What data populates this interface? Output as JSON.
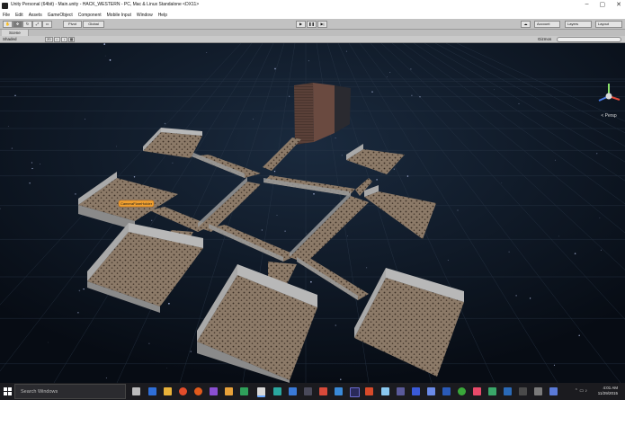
{
  "window": {
    "title": "Unity Personal (64bit) - Main.unity - HACK_WESTERN - PC, Mac & Linux Standalone <DX11>",
    "controls": [
      "–",
      "▢",
      "✕"
    ]
  },
  "menu": [
    "File",
    "Edit",
    "Assets",
    "GameObject",
    "Component",
    "Mobile Input",
    "Window",
    "Help"
  ],
  "toolbar": {
    "pivot_label": "Pivot",
    "global_label": "Global",
    "account_label": "Account",
    "layers_label": "Layers",
    "layout_label": "Layout"
  },
  "scene": {
    "tab_label": "Scene",
    "shading_mode": "Shaded",
    "mode_2d": "2D",
    "gizmos_label": "Gizmos",
    "persp_label": "< Persp",
    "object_label": "CameraFlareHolder"
  },
  "taskbar": {
    "search_placeholder": "Search Windows",
    "time": "4:01 AM",
    "date": "11/29/2015"
  },
  "colors": {
    "floor": "#8c7a68",
    "wall": "#a9a9a9",
    "label_bg": "#f0a030",
    "space": "#0c1420",
    "taskbar": "#1b1b1f"
  },
  "icons": [
    "unity-icon",
    "hand-tool-icon",
    "move-tool-icon",
    "rotate-tool-icon",
    "scale-tool-icon",
    "rect-tool-icon",
    "play-icon",
    "pause-icon",
    "step-icon",
    "cloud-icon",
    "windows-start-icon",
    "scene-gizmo-icon"
  ]
}
